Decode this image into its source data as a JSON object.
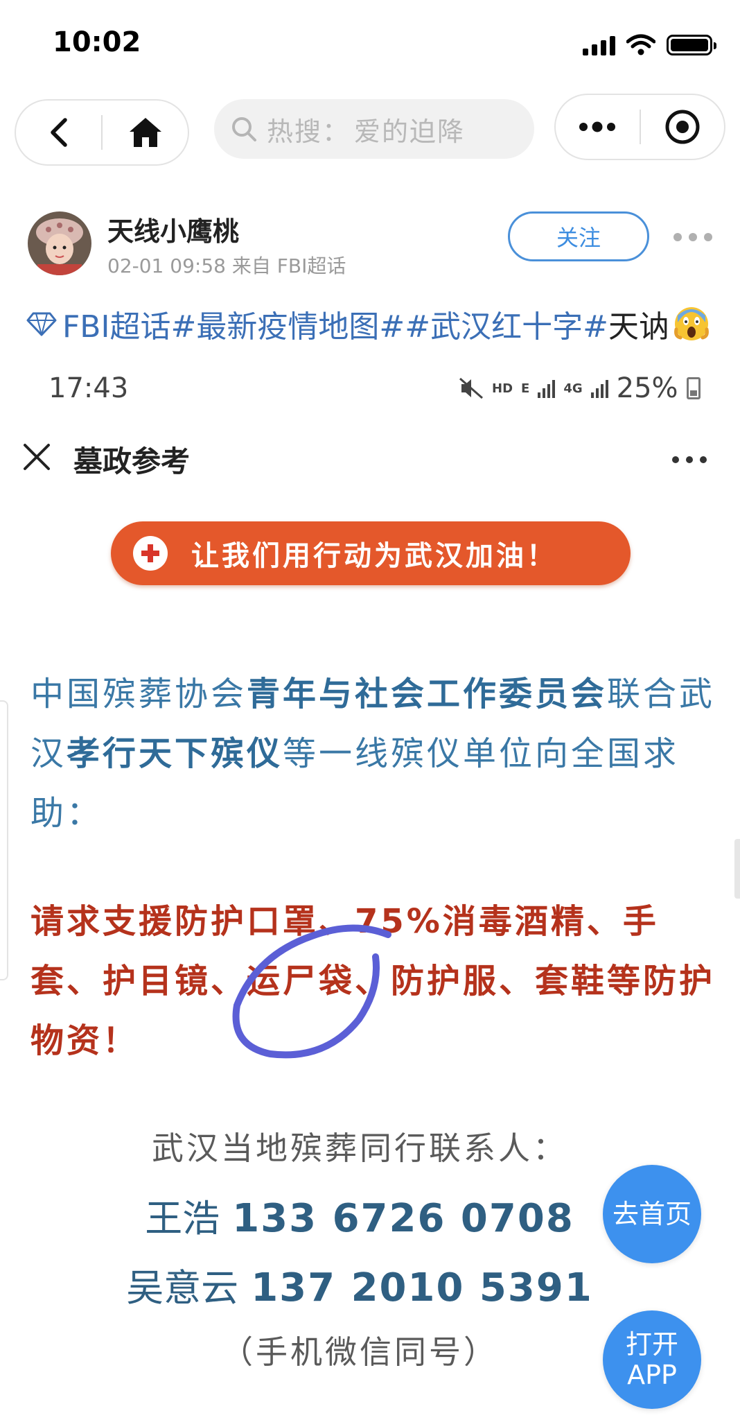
{
  "status_bar": {
    "time": "10:02"
  },
  "nav": {
    "search_prefix": "热搜：",
    "search_term": "爱的迫降"
  },
  "post": {
    "username": "天线小鹰桃",
    "meta": "02-01 09:58 来自 FBI超话",
    "follow_label": "关注",
    "tags_text": "FBI超话#最新疫情地图##武汉红十字#",
    "text_tail": "天讷"
  },
  "embedded": {
    "time": "17:43",
    "status_hd": "HD",
    "status_e": "E",
    "status_4g": "4G",
    "battery": "25%",
    "title": "墓政参考",
    "banner": "让我们用行动为武汉加油！",
    "para1": [
      {
        "text": "中国殡葬协会",
        "bold": false
      },
      {
        "text": "青年与社会工作委员会",
        "bold": true
      },
      {
        "text": "联合武汉",
        "bold": false
      },
      {
        "text": "孝行天下殡仪",
        "bold": true
      },
      {
        "text": "等一线殡仪单位向全国求助：",
        "bold": false
      }
    ],
    "para2": "请求支援防护口罩、75%消毒酒精、手套、护目镜、运尸袋、防护服、套鞋等防护物资！",
    "contacts_label": "武汉当地殡葬同行联系人：",
    "contacts": [
      {
        "name": "王浩",
        "phone": "133 6726 0708"
      },
      {
        "name": "吴意云",
        "phone": "137 2010 5391"
      }
    ],
    "note": "（手机微信同号）"
  },
  "fabs": {
    "home": "去首页",
    "open_app_line1": "打开",
    "open_app_line2": "APP"
  },
  "colors": {
    "link_blue": "#3b6fb6",
    "follow_blue": "#3d8de0",
    "banner_orange": "#e4582b",
    "alert_red": "#b5321c",
    "para_blue": "#3a78a6",
    "fab_blue": "#3d91ee",
    "annotation_purple": "#5b5fd6"
  },
  "icons": {
    "back": "chevron-left-icon",
    "home": "home-icon",
    "search": "search-icon",
    "more": "more-icon",
    "target": "target-icon",
    "diamond": "diamond-icon",
    "emoji": "scream-emoji-icon",
    "close": "close-icon"
  }
}
